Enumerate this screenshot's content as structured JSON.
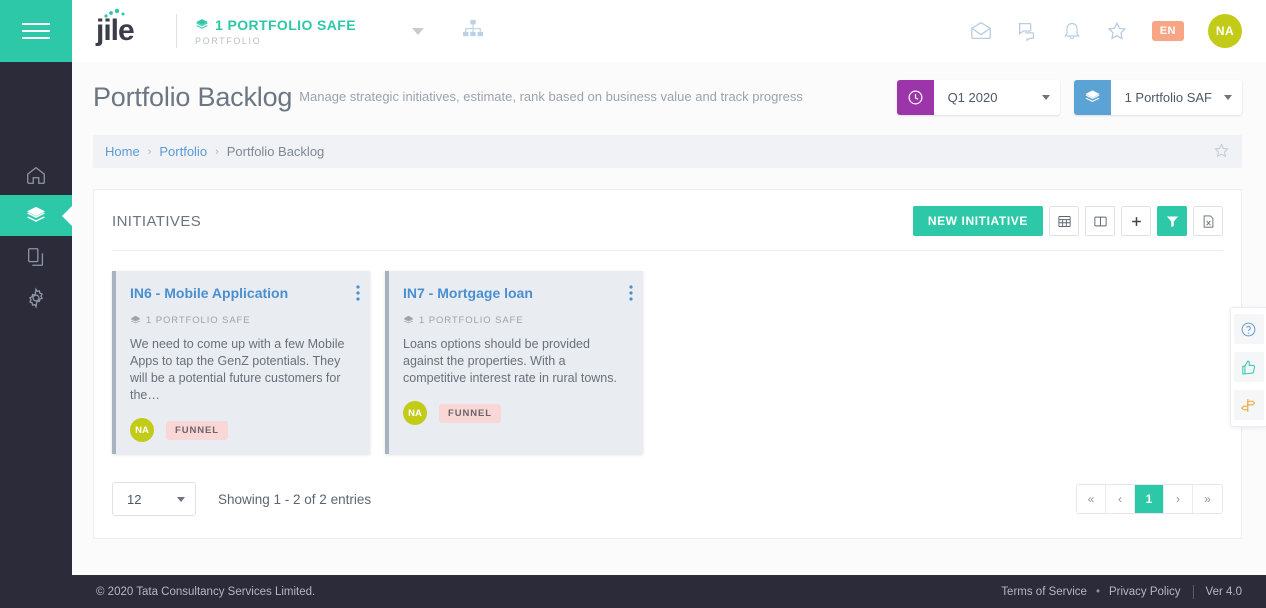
{
  "sidebar": {
    "menu_icon": "hamburger-icon",
    "items": [
      {
        "icon": "home-icon",
        "name": "home",
        "active": false
      },
      {
        "icon": "layers-icon",
        "name": "portfolio",
        "active": true
      },
      {
        "icon": "documents-icon",
        "name": "documents",
        "active": false
      },
      {
        "icon": "gear-icon",
        "name": "settings",
        "active": false
      }
    ]
  },
  "header": {
    "logo_text": "jile",
    "portfolio_name": "1 PORTFOLIO SAFE",
    "portfolio_sub": "PORTFOLIO",
    "portfolio_icon": "layers-icon",
    "dropdown_icon": "chevron-down-icon",
    "org_icon": "org-chart-icon",
    "icons": [
      "mail-icon",
      "chat-icon",
      "bell-icon",
      "star-icon"
    ],
    "language_badge": "EN",
    "avatar_initials": "NA"
  },
  "page": {
    "title": "Portfolio Backlog",
    "description": "Manage strategic initiatives, estimate, rank based on business value and track progress",
    "period_selector": {
      "icon": "clock-icon",
      "value": "Q1 2020",
      "color": "#9c35aa"
    },
    "portfolio_selector": {
      "icon": "layers-icon",
      "value": "1 Portfolio SAF",
      "color": "#5ba3d4"
    }
  },
  "breadcrumb": {
    "items": [
      "Home",
      "Portfolio",
      "Portfolio Backlog"
    ],
    "separator": "›",
    "star_icon": "star-outline-icon"
  },
  "panel": {
    "title": "INITIATIVES",
    "new_button": "NEW INITIATIVE",
    "tools": [
      {
        "name": "grid-view-icon",
        "active": false
      },
      {
        "name": "column-view-icon",
        "active": false
      },
      {
        "name": "add-icon",
        "active": false
      },
      {
        "name": "filter-icon",
        "active": true
      },
      {
        "name": "export-excel-icon",
        "active": false
      }
    ]
  },
  "cards": [
    {
      "title": "IN6 - Mobile Application",
      "meta_icon": "layers-icon",
      "meta": "1 PORTFOLIO SAFE",
      "description": "We need to come up with a few Mobile Apps to tap the GenZ potentials. They will be a potential future customers for the…",
      "avatar": "NA",
      "tag": "FUNNEL",
      "menu_icon": "kebab-menu-icon"
    },
    {
      "title": "IN7 - Mortgage loan",
      "meta_icon": "layers-icon",
      "meta": "1 PORTFOLIO SAFE",
      "description": "Loans options should be provided against the properties. With a competitive interest rate in rural towns.",
      "avatar": "NA",
      "tag": "FUNNEL",
      "menu_icon": "kebab-menu-icon"
    }
  ],
  "pagination": {
    "page_size": "12",
    "showing": "Showing 1 - 2 of 2 entries",
    "buttons": [
      "«",
      "‹",
      "1",
      "›",
      "»"
    ],
    "active_index": 2
  },
  "rail": [
    {
      "name": "help-icon",
      "color": "#5b9bd5"
    },
    {
      "name": "thumbs-up-icon",
      "color": "#2dc8a8"
    },
    {
      "name": "signpost-icon",
      "color": "#f0a836"
    }
  ],
  "footer": {
    "copyright": "© 2020 Tata Consultancy Services Limited.",
    "terms": "Terms of Service",
    "separator": "•",
    "privacy": "Privacy Policy",
    "version": "Ver 4.0"
  },
  "colors": {
    "accent": "#2dc8a8",
    "sidebar": "#2b2b3a",
    "card_bg": "#e9edf1",
    "card_title": "#4a8fd0",
    "tag_bg": "#f9d7d7",
    "avatar": "#c2cb17",
    "lang_badge": "#f7a585"
  }
}
